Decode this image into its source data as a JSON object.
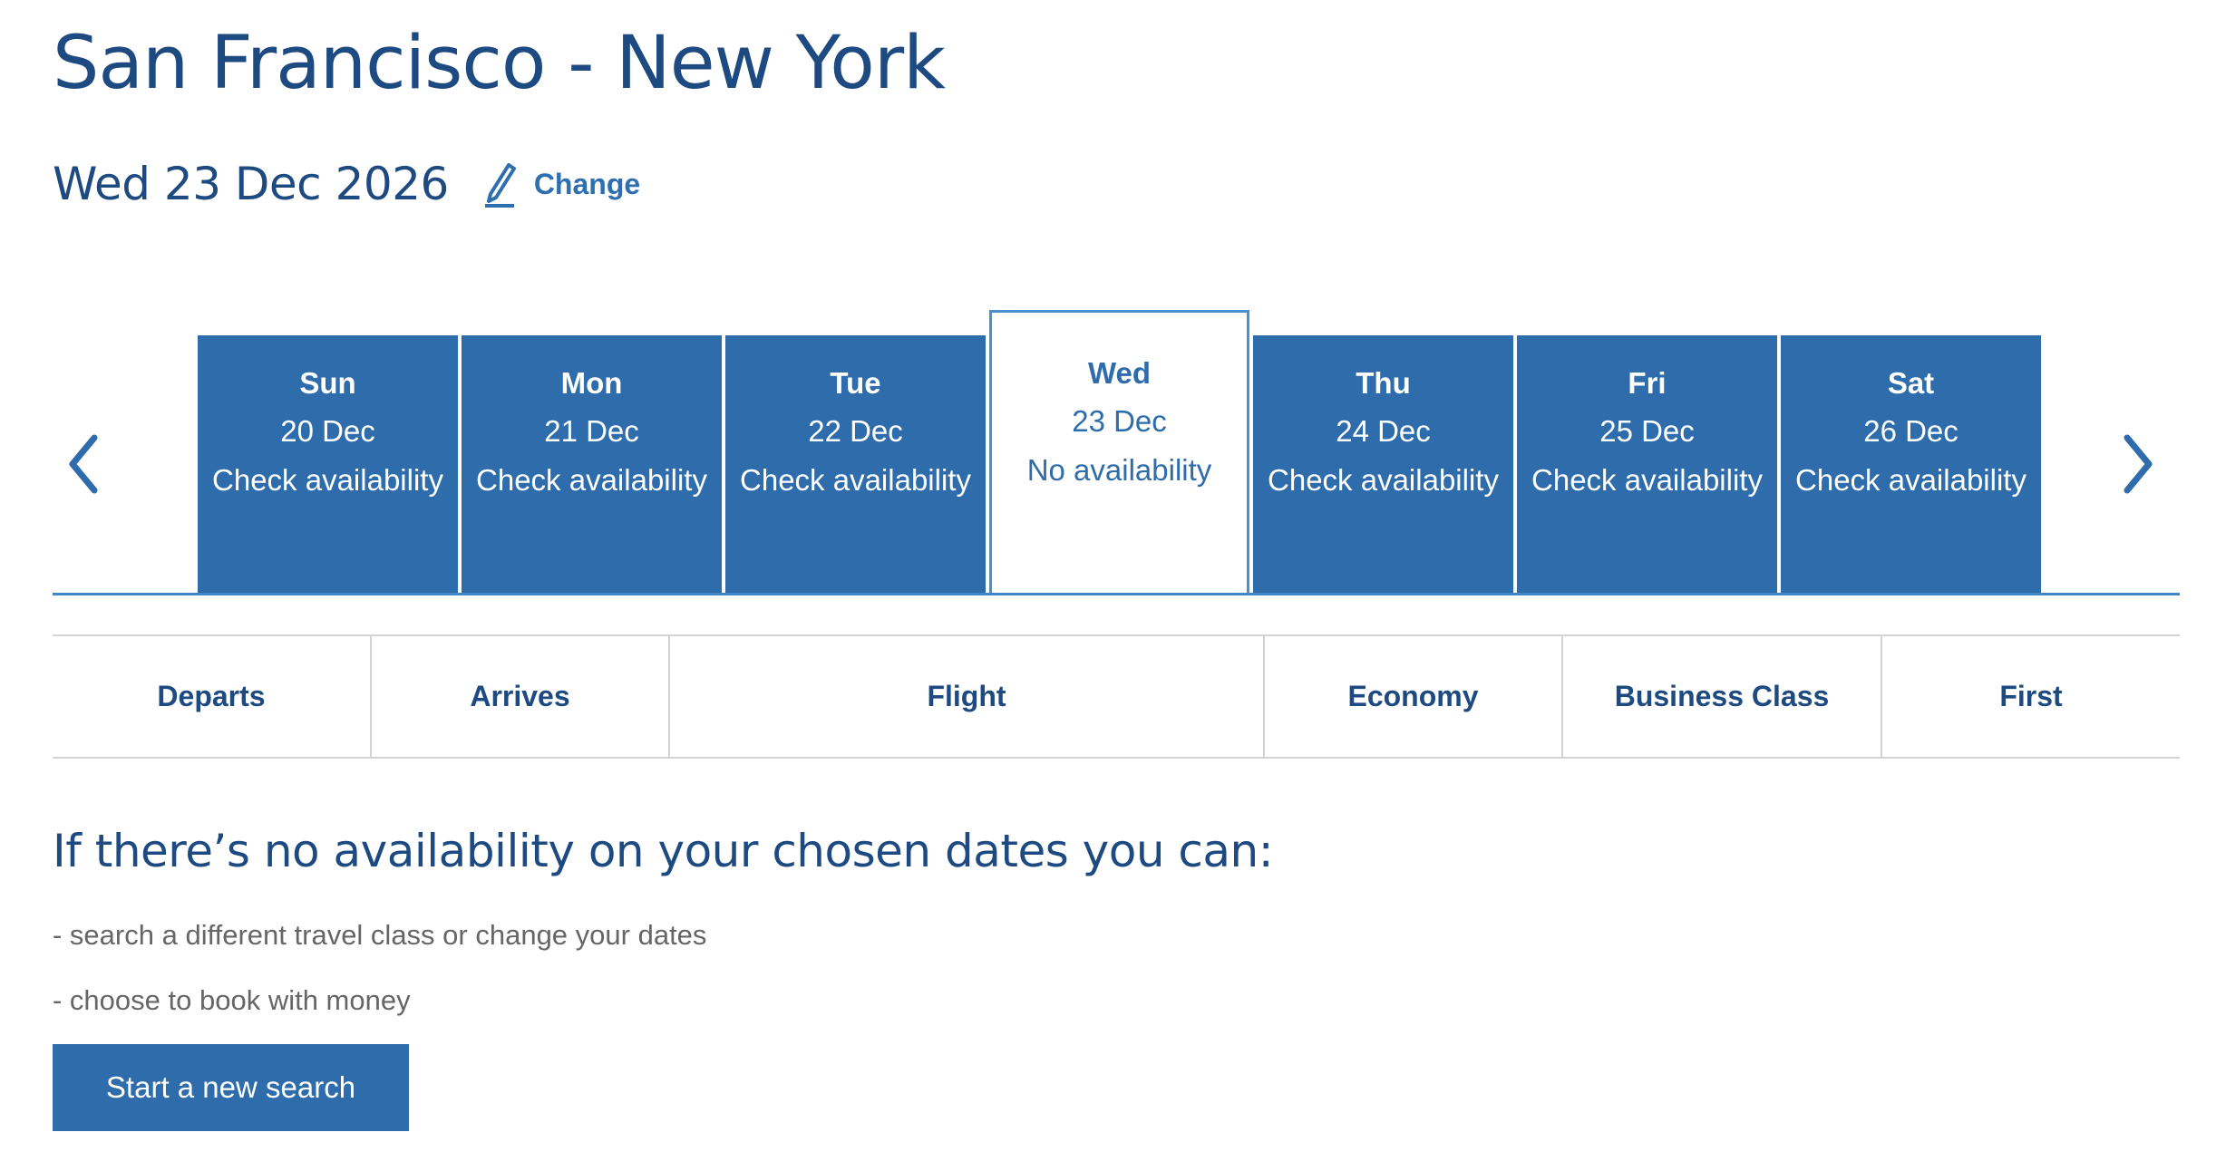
{
  "route": {
    "title": "San Francisco - New York"
  },
  "date": {
    "selected": "Wed 23 Dec 2026",
    "change_label": "Change"
  },
  "colors": {
    "primary": "#2e6cab",
    "heading": "#1e4a82",
    "link": "#2e6fb0",
    "selected_border": "#4a8fd0"
  },
  "carousel": {
    "prev_icon": "chevron-left-icon",
    "next_icon": "chevron-right-icon",
    "days": [
      {
        "day": "Sun",
        "date": "20 Dec",
        "status": "Check availability",
        "selected": false
      },
      {
        "day": "Mon",
        "date": "21 Dec",
        "status": "Check availability",
        "selected": false
      },
      {
        "day": "Tue",
        "date": "22 Dec",
        "status": "Check availability",
        "selected": false
      },
      {
        "day": "Wed",
        "date": "23 Dec",
        "status": "No availability",
        "selected": true
      },
      {
        "day": "Thu",
        "date": "24 Dec",
        "status": "Check availability",
        "selected": false
      },
      {
        "day": "Fri",
        "date": "25 Dec",
        "status": "Check availability",
        "selected": false
      },
      {
        "day": "Sat",
        "date": "26 Dec",
        "status": "Check availability",
        "selected": false
      }
    ]
  },
  "table": {
    "columns": [
      "Departs",
      "Arrives",
      "Flight",
      "Economy",
      "Business Class",
      "First"
    ]
  },
  "info": {
    "heading": "If there’s no availability on your chosen dates you can:",
    "line1": "- search a different travel class or change your dates",
    "line2": "- choose to book with money"
  },
  "actions": {
    "new_search": "Start a new search"
  }
}
